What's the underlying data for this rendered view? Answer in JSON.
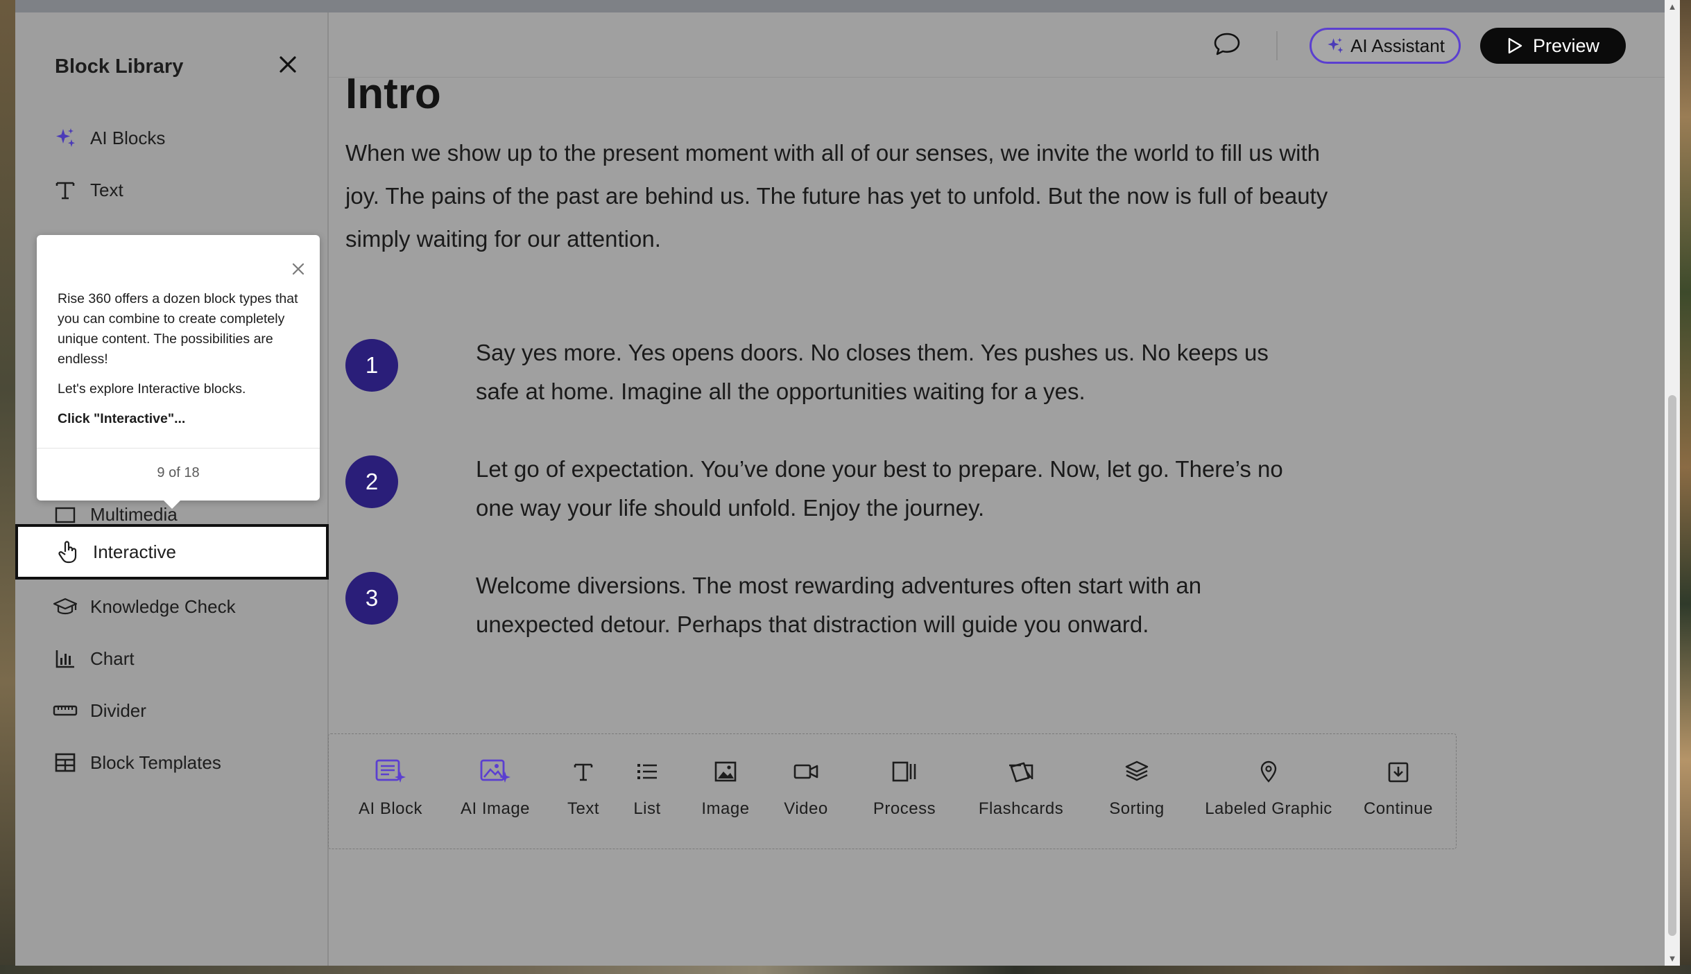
{
  "sidebar": {
    "title": "Block Library",
    "items": [
      {
        "label": "AI Blocks",
        "icon": "sparkle-icon"
      },
      {
        "label": "Text",
        "icon": "text-icon"
      },
      {
        "label": "Multimedia",
        "icon": "multimedia-icon"
      },
      {
        "label": "Interactive",
        "icon": "hand-pointer-icon"
      },
      {
        "label": "Knowledge Check",
        "icon": "graduation-cap-icon"
      },
      {
        "label": "Chart",
        "icon": "bar-chart-icon"
      },
      {
        "label": "Divider",
        "icon": "ruler-icon"
      },
      {
        "label": "Block Templates",
        "icon": "table-icon"
      }
    ]
  },
  "tooltip": {
    "body_1": "Rise 360 offers a dozen block types that you can combine to create completely unique content. The possibilities are endless!",
    "body_2": "Let's explore Interactive blocks.",
    "cta": "Click \"Interactive\"...",
    "counter": "9 of 18"
  },
  "header": {
    "ai_assistant_label": "AI Assistant",
    "preview_label": "Preview"
  },
  "content": {
    "title": "Intro",
    "intro": "When we show up to the present moment with all of our senses, we invite the world to fill us with joy. The pains of the past are behind us. The future has yet to unfold. But the now is full of beauty simply waiting for our attention.",
    "steps": [
      {
        "number": "1",
        "text": "Say yes more. Yes opens doors. No closes them. Yes pushes us. No keeps us safe at home. Imagine all the opportunities waiting for a yes."
      },
      {
        "number": "2",
        "text": "Let go of expectation. You’ve done your best to prepare. Now, let go. There’s no one way your life should unfold. Enjoy the journey."
      },
      {
        "number": "3",
        "text": "Welcome diversions. The most rewarding adventures often start with an unexpected detour. Perhaps that distraction will guide you onward."
      }
    ]
  },
  "block_bar": {
    "items": [
      {
        "label": "AI Block",
        "icon": "ai-block-icon"
      },
      {
        "label": "AI Image",
        "icon": "ai-image-icon"
      },
      {
        "label": "Text",
        "icon": "text-icon"
      },
      {
        "label": "List",
        "icon": "list-icon"
      },
      {
        "label": "Image",
        "icon": "image-icon"
      },
      {
        "label": "Video",
        "icon": "video-icon"
      },
      {
        "label": "Process",
        "icon": "process-icon"
      },
      {
        "label": "Flashcards",
        "icon": "flashcards-icon"
      },
      {
        "label": "Sorting",
        "icon": "sorting-icon"
      },
      {
        "label": "Labeled Graphic",
        "icon": "map-pin-icon"
      },
      {
        "label": "Continue",
        "icon": "continue-icon"
      }
    ]
  },
  "colors": {
    "accent": "#2a1e79",
    "ai_purple": "#5b3fd0",
    "overlay": "#a0a0a0"
  }
}
